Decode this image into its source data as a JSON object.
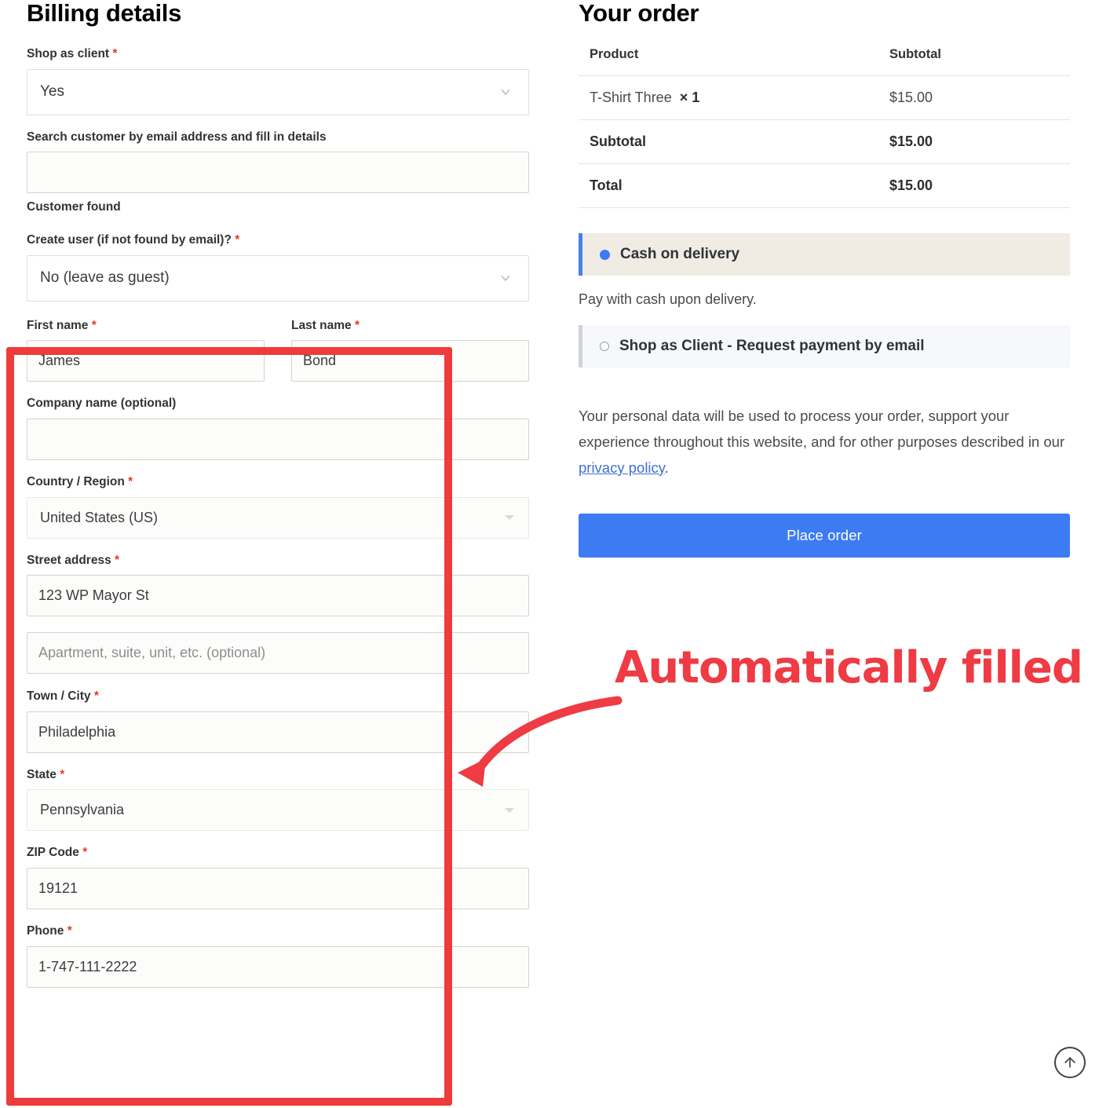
{
  "billing": {
    "title": "Billing details",
    "shop_as_client": {
      "label": "Shop as client",
      "required": "*",
      "value": "Yes",
      "icon": "chevron-down-icon"
    },
    "search_customer": {
      "label": "Search customer by email address and fill in details",
      "value": "",
      "placeholder": "",
      "status": "Customer found"
    },
    "create_user": {
      "label": "Create user (if not found by email)?",
      "required": "*",
      "value": "No (leave as guest)",
      "icon": "chevron-down-icon"
    },
    "first_name": {
      "label": "First name",
      "required": "*",
      "value": "James"
    },
    "last_name": {
      "label": "Last name",
      "required": "*",
      "value": "Bond"
    },
    "company": {
      "label": "Company name (optional)",
      "value": ""
    },
    "country": {
      "label": "Country / Region",
      "required": "*",
      "value": "United States (US)",
      "icon": "caret-down-icon"
    },
    "street": {
      "label": "Street address",
      "required": "*",
      "value": "123 WP Mayor St"
    },
    "street2": {
      "value": "",
      "placeholder": "Apartment, suite, unit, etc. (optional)"
    },
    "city": {
      "label": "Town / City",
      "required": "*",
      "value": "Philadelphia"
    },
    "state": {
      "label": "State",
      "required": "*",
      "value": "Pennsylvania",
      "icon": "caret-down-icon"
    },
    "zip": {
      "label": "ZIP Code",
      "required": "*",
      "value": "19121"
    },
    "phone": {
      "label": "Phone",
      "required": "*",
      "value": "1-747-111-2222"
    }
  },
  "order": {
    "title": "Your order",
    "headers": {
      "product": "Product",
      "subtotal": "Subtotal"
    },
    "items": [
      {
        "name": "T-Shirt Three",
        "times": "×",
        "qty": "1",
        "amount": "$15.00"
      }
    ],
    "subtotal": {
      "label": "Subtotal",
      "amount": "$15.00"
    },
    "total": {
      "label": "Total",
      "amount": "$15.00"
    },
    "payment_methods": [
      {
        "label": "Cash on delivery",
        "selected": true,
        "description": "Pay with cash upon delivery."
      },
      {
        "label": "Shop as Client - Request payment by email",
        "selected": false
      }
    ],
    "privacy": {
      "text_before": "Your personal data will be used to process your order, support your experience throughout this website, and for other purposes described in our ",
      "link": "privacy policy",
      "text_after": "."
    },
    "place_order_label": "Place order"
  },
  "annotation": {
    "text": "Automatically filled",
    "color": "#ee3b44",
    "box_color": "#ee3b3b"
  },
  "scroll_top": {
    "icon": "arrow-up-icon"
  },
  "colors": {
    "accent_blue": "#3d7bf2",
    "link_blue": "#3d6fd6",
    "required_red": "#e2401c",
    "annotation_red": "#ee3b44",
    "payment_active_bg": "#f0ece3",
    "payment_inactive_bg": "#f6f8fb",
    "input_border": "#d3d6c8"
  }
}
